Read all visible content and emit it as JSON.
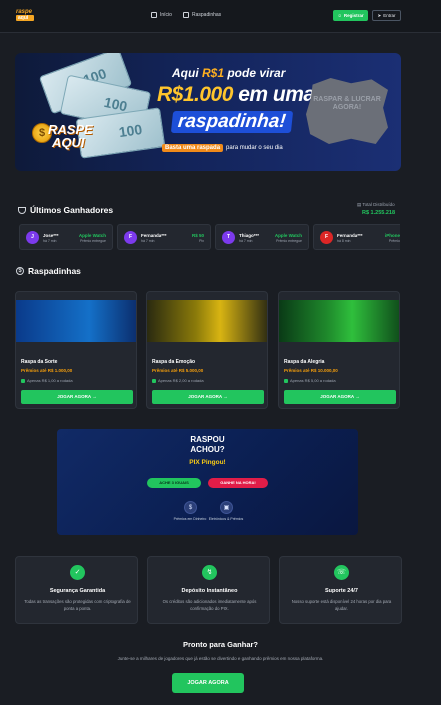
{
  "header": {
    "logo_line1": "raspe",
    "logo_line2": "aqui",
    "nav": [
      {
        "label": "Início",
        "icon": "home-icon"
      },
      {
        "label": "Raspadinhas",
        "icon": "grid-icon"
      }
    ],
    "register_label": "Registrar",
    "login_label": "Entrar"
  },
  "banner": {
    "money_label": "100",
    "line1_prefix": "Aqui ",
    "line1_highlight": "R$1",
    "line1_suffix": " pode virar",
    "line2_amount": "R$1.000",
    "line2_suffix": " em uma",
    "line3": "raspadinha!",
    "sub_pill": "Basta uma raspada",
    "sub_text": "para mudar o seu dia",
    "brand_line1": "RASPE",
    "brand_line2": "AQUI",
    "scratch_text": "RASPAR & LUCRAR AGORA!"
  },
  "winners": {
    "title": "Últimos Ganhadores",
    "total_label": "Total Distribuído",
    "total_value": "R$ 1.255.218",
    "items": [
      {
        "initial": "J",
        "name": "Jose***",
        "time": "há 7 min",
        "prize": "Apple Watch",
        "sub": "Prêmio entregue",
        "color": "#7c3aed"
      },
      {
        "initial": "F",
        "name": "Fernanda***",
        "time": "há 7 min",
        "prize": "R$ 50",
        "sub": "Pix",
        "color": "#7c3aed"
      },
      {
        "initial": "T",
        "name": "Thiago***",
        "time": "há 7 min",
        "prize": "Apple Watch",
        "sub": "Prêmio entregue",
        "color": "#7c3aed"
      },
      {
        "initial": "F",
        "name": "Fernanda***",
        "time": "há 8 min",
        "prize": "iPhone",
        "sub": "Prêmio",
        "color": "#dc2626"
      }
    ]
  },
  "raspadinhas": {
    "title": "Raspadinhas",
    "cards": [
      {
        "title": "Raspa da Sorte",
        "prize": "Prêmios até R$ 1.000,00",
        "from": "Apenas R$ 1,00 a rodada",
        "button": "JOGAR AGORA →"
      },
      {
        "title": "Raspa da Emoção",
        "prize": "Prêmios até R$ 5.000,00",
        "from": "Apenas R$ 2,00 a rodada",
        "button": "JOGAR AGORA →"
      },
      {
        "title": "Raspa da Alegria",
        "prize": "Prêmios até R$ 10.000,00",
        "from": "Apenas R$ 5,00 a rodada",
        "button": "JOGAR AGORA →"
      }
    ]
  },
  "pix": {
    "line1": "RASPOU",
    "line2": "ACHOU?",
    "line3": "PIX Pingou!",
    "btn_play": "ACHE 3 IGUAIS",
    "btn_win": "GANHE NA HORA!",
    "feature1": "Prêmios em Dinheiro",
    "feature2": "Eletrônicos & Prêmios"
  },
  "features": [
    {
      "title": "Segurança Garantida",
      "desc": "Todas as transações são protegidas com criptografia de ponta a ponta.",
      "icon": "shield-icon"
    },
    {
      "title": "Depósito Instantâneo",
      "desc": "Os créditos são adicionados imediatamente após confirmação do PIX.",
      "icon": "bolt-icon"
    },
    {
      "title": "Suporte 24/7",
      "desc": "Nosso suporte está disponível 24 horas por dia para ajudar.",
      "icon": "phone-icon"
    }
  ],
  "cta": {
    "title": "Pronto para Ganhar?",
    "desc": "Junte-se a milhares de jogadores que já estão se divertindo e ganhando prêmios em nossa plataforma.",
    "button": "JOGAR AGORA"
  },
  "colors": {
    "accent": "#22c55e",
    "background": "#1a1d23",
    "card": "#23272f",
    "gold": "#f59e0b"
  }
}
